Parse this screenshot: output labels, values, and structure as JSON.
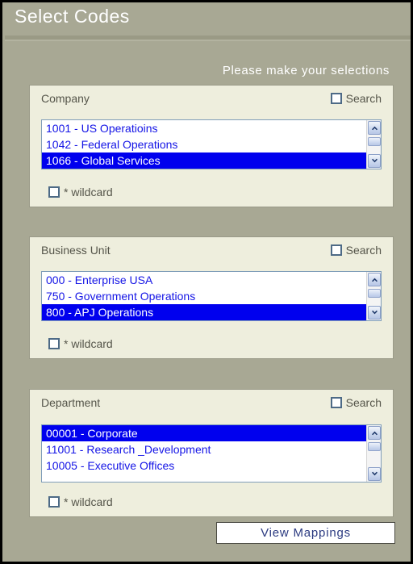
{
  "header": {
    "title": "Select Codes"
  },
  "instruction": "Please make your selections",
  "colors": {
    "page_background": "#a8a894",
    "panel_background": "#eeeedd",
    "selection_blue": "#0000ee",
    "list_text_blue": "#1414e6",
    "label_gray": "#55554a",
    "header_text": "#ffffff",
    "button_text": "#2b3a80",
    "checkbox_border": "#4d6a86"
  },
  "groups": [
    {
      "label": "Company",
      "search": {
        "label": "Search",
        "checked": false
      },
      "wildcard": {
        "label": "* wildcard",
        "checked": false
      },
      "items": [
        {
          "text": "1001 - US Operatioins",
          "selected": false
        },
        {
          "text": "1042 - Federal Operations",
          "selected": false
        },
        {
          "text": "1066 - Global Services",
          "selected": true
        }
      ],
      "scrollbar": {
        "up_icon": "chevron-up-icon",
        "down_icon": "chevron-down-icon"
      }
    },
    {
      "label": "Business Unit",
      "search": {
        "label": "Search",
        "checked": false
      },
      "wildcard": {
        "label": "* wildcard",
        "checked": false
      },
      "items": [
        {
          "text": "000 - Enterprise USA",
          "selected": false
        },
        {
          "text": "750 - Government Operations",
          "selected": false
        },
        {
          "text": "800 - APJ Operations",
          "selected": true
        }
      ],
      "scrollbar": {
        "up_icon": "chevron-up-icon",
        "down_icon": "chevron-down-icon"
      }
    },
    {
      "label": "Department",
      "search": {
        "label": "Search",
        "checked": false
      },
      "wildcard": {
        "label": "* wildcard",
        "checked": false
      },
      "items": [
        {
          "text": "00001 - Corporate",
          "selected": true
        },
        {
          "text": "11001 - Research _Development",
          "selected": false
        },
        {
          "text": "10005 - Executive Offices",
          "selected": false
        }
      ],
      "scrollbar": {
        "up_icon": "chevron-up-icon",
        "down_icon": "chevron-down-icon"
      }
    }
  ],
  "footer": {
    "view_mappings_label": "View Mappings"
  }
}
